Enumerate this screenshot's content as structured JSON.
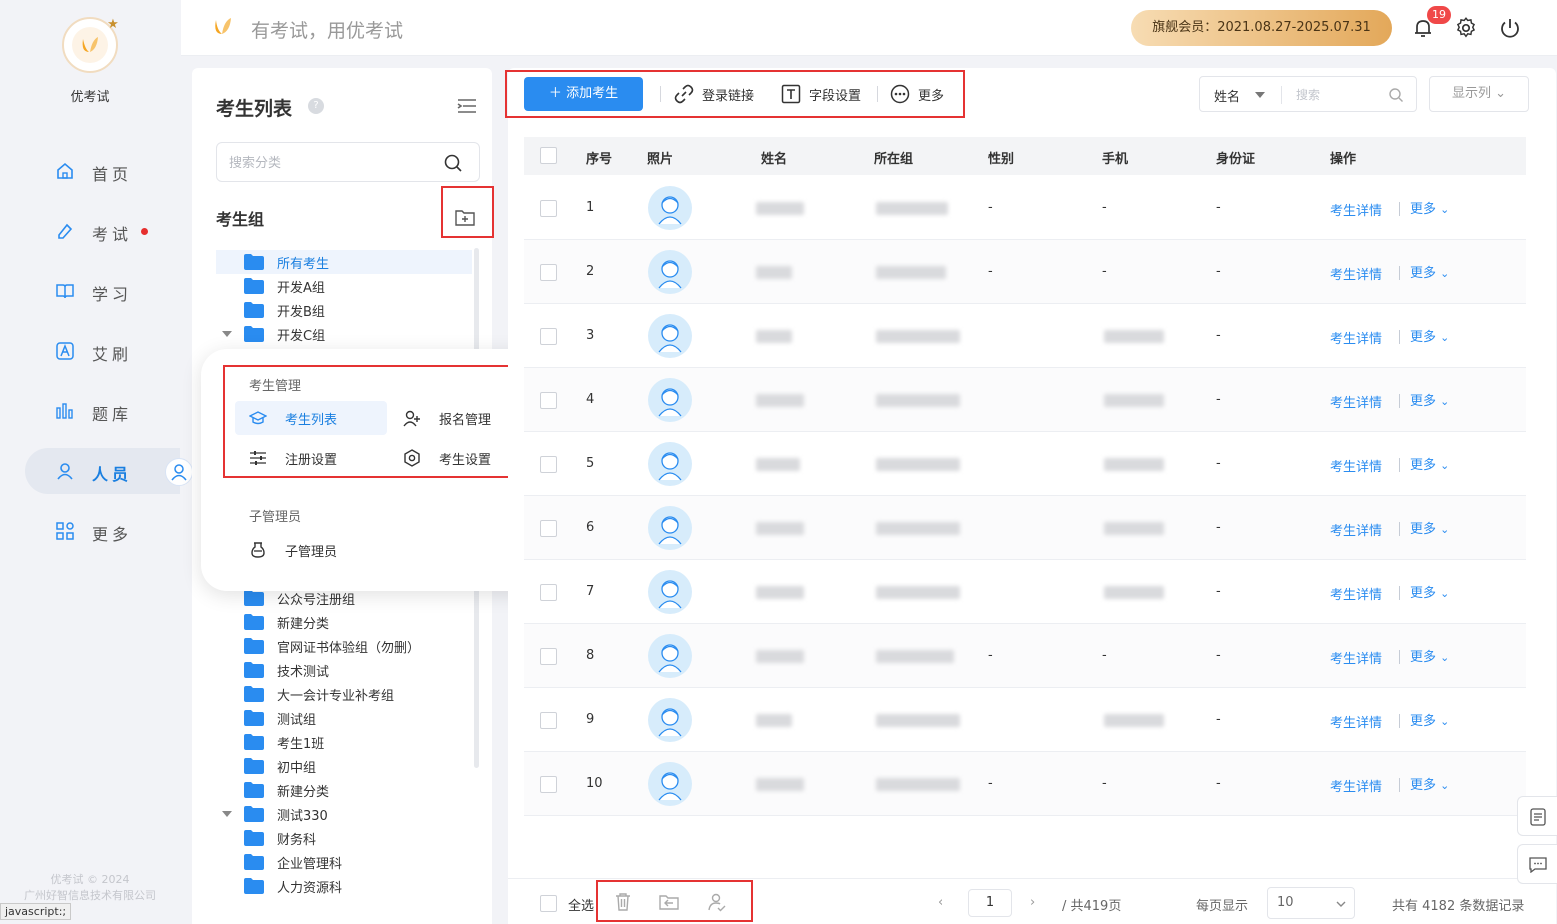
{
  "app": {
    "name": "优考试",
    "slogan": "有考试，用优考试",
    "copyright": "优考试 © 2024",
    "company": "广州好智信息技术有限公司",
    "status_url": "javascript:;"
  },
  "topbar": {
    "membership": "旗舰会员：2021.08.27-2025.07.31",
    "notification_count": "19"
  },
  "nav": [
    {
      "label": "首页",
      "icon": "home-icon"
    },
    {
      "label": "考试",
      "icon": "exam-icon",
      "dot": true
    },
    {
      "label": "学习",
      "icon": "book-icon"
    },
    {
      "label": "艾刷",
      "icon": "a-icon"
    },
    {
      "label": "题库",
      "icon": "bars-icon"
    },
    {
      "label": "人员",
      "icon": "user-icon",
      "active": true
    },
    {
      "label": "更多",
      "icon": "grid-icon"
    }
  ],
  "side": {
    "title": "考生列表",
    "search_placeholder": "搜索分类",
    "group_title": "考生组",
    "tree_top": [
      "所有考生",
      "开发A组",
      "开发B组",
      "开发C组"
    ],
    "tree_bottom": [
      "公众号注册组",
      "新建分类",
      "官网证书体验组（勿删）",
      "技术测试",
      "大一会计专业补考组",
      "测试组",
      "考生1班",
      "初中组",
      "新建分类",
      "测试330",
      "财务科",
      "企业管理科",
      "人力资源科"
    ]
  },
  "popup": {
    "section1": "考生管理",
    "items": [
      "考生列表",
      "报名管理",
      "注册设置",
      "考生设置"
    ],
    "section2": "子管理员",
    "sub_item": "子管理员"
  },
  "toolbar": {
    "add": "添加考生",
    "login_link": "登录链接",
    "field_settings": "字段设置",
    "more": "更多",
    "filter_field": "姓名",
    "search_placeholder": "搜索",
    "columns": "显示列"
  },
  "table": {
    "headers": [
      "序号",
      "照片",
      "姓名",
      "所在组",
      "性别",
      "手机",
      "身份证",
      "操作"
    ],
    "rows": [
      {
        "no": "1",
        "gender": "-",
        "phone": "-",
        "id": "-"
      },
      {
        "no": "2",
        "gender": "-",
        "phone": "-",
        "id": "-"
      },
      {
        "no": "3",
        "gender": "",
        "phone": "",
        "id": "-"
      },
      {
        "no": "4",
        "gender": "",
        "phone": "",
        "id": "-"
      },
      {
        "no": "5",
        "gender": "",
        "phone": "",
        "id": "-"
      },
      {
        "no": "6",
        "gender": "",
        "phone": "",
        "id": "-"
      },
      {
        "no": "7",
        "gender": "",
        "phone": "",
        "id": "-"
      },
      {
        "no": "8",
        "gender": "-",
        "phone": "-",
        "id": "-"
      },
      {
        "no": "9",
        "gender": "",
        "phone": "",
        "id": "-"
      },
      {
        "no": "10",
        "gender": "-",
        "phone": "-",
        "id": "-"
      }
    ],
    "detail_label": "考生详情",
    "more_label": "更多"
  },
  "footer": {
    "select_all": "全选",
    "page": "1",
    "total_pages": "/ 共419页",
    "page_size_label": "每页显示",
    "page_size": "10",
    "total_records": "共有 4182 条数据记录"
  },
  "colors": {
    "primary": "#2a8cf0",
    "highlight": "#e53333",
    "badge": "#f04848"
  }
}
